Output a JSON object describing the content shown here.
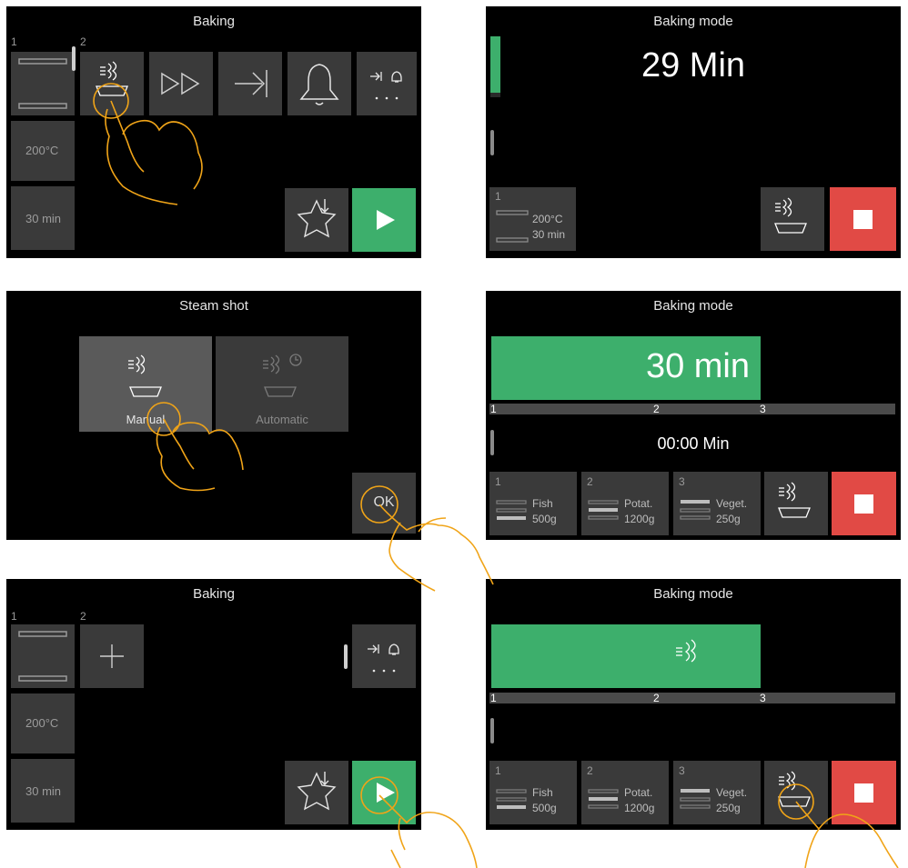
{
  "colors": {
    "accent_green": "#3daf6c",
    "stop_red": "#e14a45",
    "tile": "#3a3a3a",
    "touch_overlay": "#f0a418"
  },
  "p1": {
    "title": "Baking",
    "tray_num_1": "1",
    "tray_num_2": "2",
    "temp": "200°C",
    "time": "30 min"
  },
  "p2": {
    "title": "Baking mode",
    "timer": "29 Min",
    "progress_fraction": 0.08,
    "tray_num": "1",
    "tray_temp": "200°C",
    "tray_time": "30 min"
  },
  "p3": {
    "title": "Steam shot",
    "manual_label": "Manual",
    "automatic_label": "Automatic",
    "ok_label": "OK"
  },
  "p4": {
    "title": "Baking mode",
    "bar_value": "30 min",
    "marker_1": "1",
    "marker_2": "2",
    "marker_3": "3",
    "elapsed": "00:00 Min",
    "trays": [
      {
        "num": "1",
        "food": "Fish",
        "weight": "500g"
      },
      {
        "num": "2",
        "food": "Potat.",
        "weight": "1200g"
      },
      {
        "num": "3",
        "food": "Veget.",
        "weight": "250g"
      }
    ]
  },
  "p5": {
    "title": "Baking",
    "tray_num_1": "1",
    "tray_num_2": "2",
    "temp": "200°C",
    "time": "30 min"
  },
  "p6": {
    "title": "Baking mode",
    "marker_1": "1",
    "marker_2": "2",
    "marker_3": "3",
    "trays": [
      {
        "num": "1",
        "food": "Fish",
        "weight": "500g"
      },
      {
        "num": "2",
        "food": "Potat.",
        "weight": "1200g"
      },
      {
        "num": "3",
        "food": "Veget.",
        "weight": "250g"
      }
    ]
  }
}
